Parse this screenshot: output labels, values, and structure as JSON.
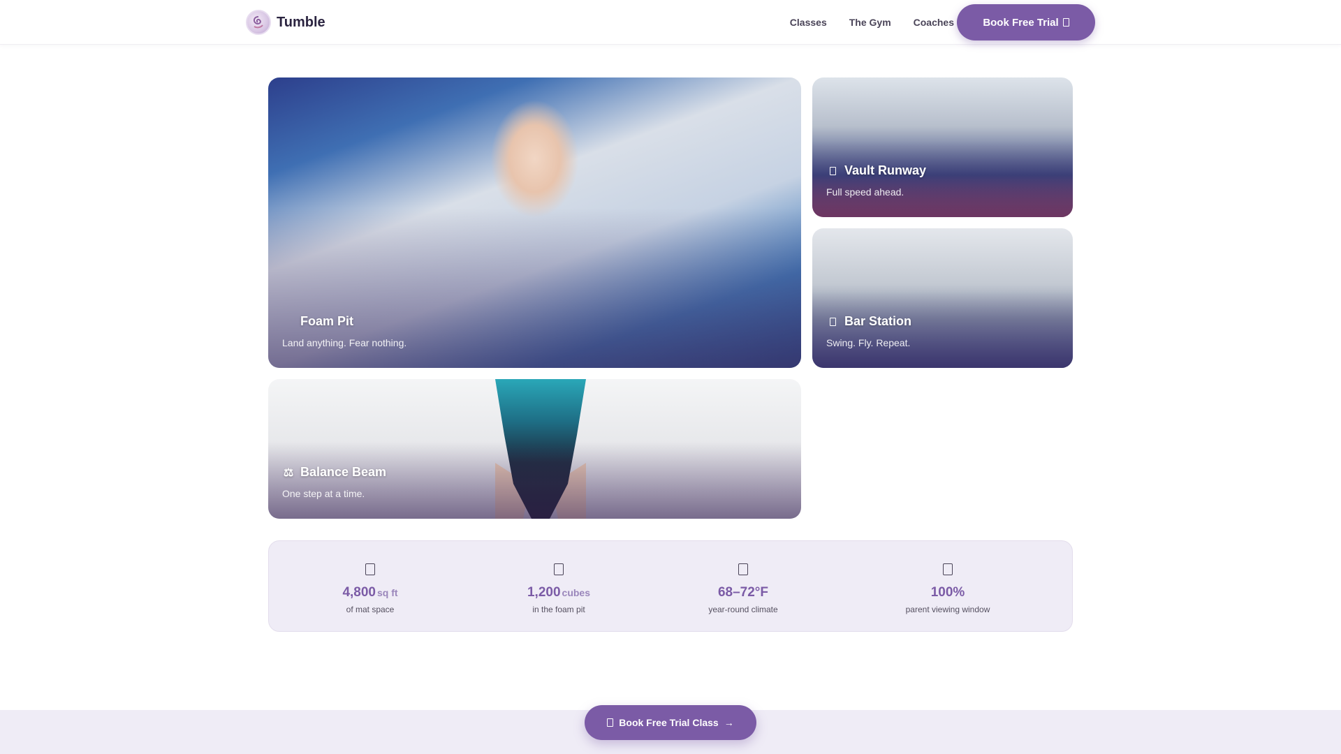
{
  "brand": {
    "name": "Tumble"
  },
  "nav": {
    "items": [
      {
        "label": "Classes"
      },
      {
        "label": "The Gym"
      },
      {
        "label": "Coaches"
      }
    ],
    "cta_label": "Book Free Trial"
  },
  "gallery": {
    "cards": [
      {
        "title": "Foam Pit",
        "subtitle": "Land anything. Fear nothing.",
        "icon": "cube-icon"
      },
      {
        "title": "Vault Runway",
        "subtitle": "Full speed ahead.",
        "icon": "runner-icon"
      },
      {
        "title": "Bar Station",
        "subtitle": "Swing. Fly. Repeat.",
        "icon": "bar-icon"
      },
      {
        "title": "Balance Beam",
        "subtitle": "One step at a time.",
        "icon": "balance-scale-icon",
        "icon_glyph": "⚖"
      }
    ]
  },
  "stats": [
    {
      "value": "4,800",
      "unit": "sq ft",
      "label": "of mat space",
      "icon": "mat-icon"
    },
    {
      "value": "1,200",
      "unit": "cubes",
      "label": "in the foam pit",
      "icon": "cube-icon"
    },
    {
      "value": "68–72°F",
      "unit": "",
      "label": "year-round climate",
      "icon": "thermometer-icon"
    },
    {
      "value": "100%",
      "unit": "",
      "label": "parent viewing window",
      "icon": "eye-icon"
    }
  ],
  "footer": {
    "cta_label": "Book Free Trial Class",
    "cta_arrow": "→"
  },
  "colors": {
    "accent": "#7b5ba6",
    "stats_bg": "#efecf6",
    "text_dark": "#2b2440"
  }
}
